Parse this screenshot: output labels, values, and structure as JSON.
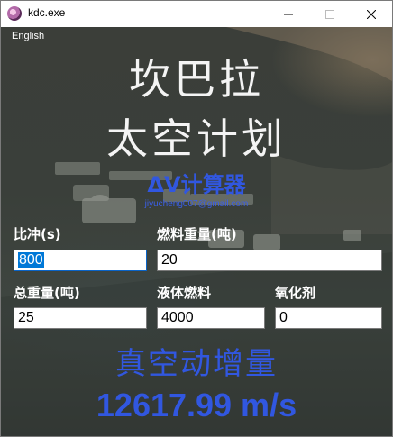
{
  "window": {
    "title": "kdc.exe",
    "icon": "kerbal-app-icon"
  },
  "language_link": "English",
  "header": {
    "line1": "坎巴拉",
    "line2": "太空计划"
  },
  "subtitle": "ΔV计算器",
  "email": "jiyucheng007@gmail.com",
  "fields": {
    "isp": {
      "label": "比冲(s)",
      "value": "800"
    },
    "fuel_mass": {
      "label": "燃料重量(吨)",
      "value": "20"
    },
    "total_mass": {
      "label": "总重量(吨)",
      "value": "25"
    },
    "liquid_fuel": {
      "label": "液体燃料",
      "value": "4000"
    },
    "oxidizer": {
      "label": "氧化剂",
      "value": "0"
    }
  },
  "result": {
    "label": "真空动增量",
    "value": "12617.99 m/s"
  },
  "colors": {
    "accent": "#3157e0",
    "background": "#3b3f3a",
    "text": "#f4f4f4"
  }
}
